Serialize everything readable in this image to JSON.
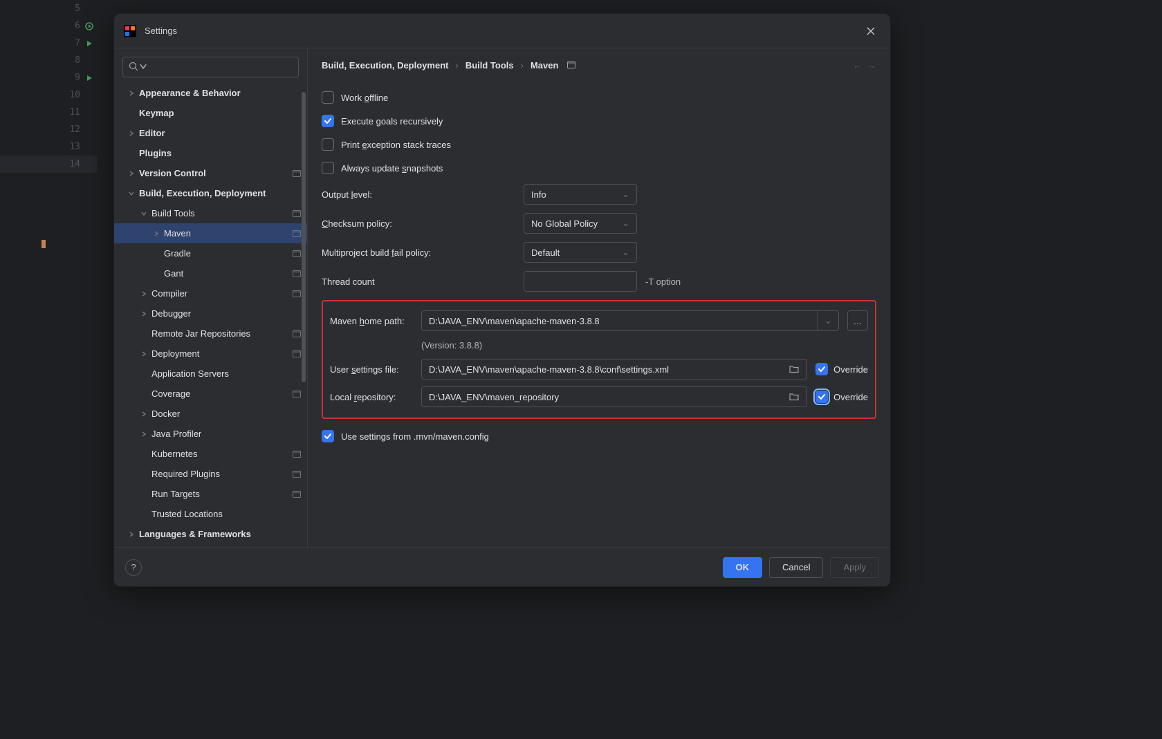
{
  "gutter": {
    "start": 5,
    "end": 14,
    "highlighted": 14,
    "run_icons": [
      6,
      7,
      9
    ]
  },
  "dialog": {
    "title": "Settings",
    "search_placeholder": "",
    "breadcrumbs": [
      "Build, Execution, Deployment",
      "Build Tools",
      "Maven"
    ],
    "tree": [
      {
        "label": "Appearance & Behavior",
        "arrow": "right",
        "bold": true,
        "proj": false
      },
      {
        "label": "Keymap",
        "arrow": "none",
        "bold": true,
        "proj": false
      },
      {
        "label": "Editor",
        "arrow": "right",
        "bold": true,
        "proj": false
      },
      {
        "label": "Plugins",
        "arrow": "none",
        "bold": true,
        "proj": false
      },
      {
        "label": "Version Control",
        "arrow": "right",
        "bold": true,
        "proj": true
      },
      {
        "label": "Build, Execution, Deployment",
        "arrow": "down",
        "bold": true,
        "proj": false
      },
      {
        "label": "Build Tools",
        "arrow": "down",
        "indent": 1,
        "proj": true
      },
      {
        "label": "Maven",
        "arrow": "right",
        "indent": 2,
        "proj": true,
        "selected": true
      },
      {
        "label": "Gradle",
        "arrow": "none",
        "indent": 2,
        "proj": true
      },
      {
        "label": "Gant",
        "arrow": "none",
        "indent": 2,
        "proj": true
      },
      {
        "label": "Compiler",
        "arrow": "right",
        "indent": 1,
        "proj": true
      },
      {
        "label": "Debugger",
        "arrow": "right",
        "indent": 1,
        "proj": false
      },
      {
        "label": "Remote Jar Repositories",
        "arrow": "none",
        "indent": 1,
        "proj": true
      },
      {
        "label": "Deployment",
        "arrow": "right",
        "indent": 1,
        "proj": true
      },
      {
        "label": "Application Servers",
        "arrow": "none",
        "indent": 1,
        "proj": false
      },
      {
        "label": "Coverage",
        "arrow": "none",
        "indent": 1,
        "proj": true
      },
      {
        "label": "Docker",
        "arrow": "right",
        "indent": 1,
        "proj": false
      },
      {
        "label": "Java Profiler",
        "arrow": "right",
        "indent": 1,
        "proj": false
      },
      {
        "label": "Kubernetes",
        "arrow": "none",
        "indent": 1,
        "proj": true
      },
      {
        "label": "Required Plugins",
        "arrow": "none",
        "indent": 1,
        "proj": true
      },
      {
        "label": "Run Targets",
        "arrow": "none",
        "indent": 1,
        "proj": true
      },
      {
        "label": "Trusted Locations",
        "arrow": "none",
        "indent": 1,
        "proj": false
      },
      {
        "label": "Languages & Frameworks",
        "arrow": "right",
        "bold": true,
        "proj": false
      }
    ],
    "checks": {
      "work_offline": {
        "label": "Work offline",
        "underline": "o",
        "checked": false
      },
      "exec_goals": {
        "label": "Execute goals recursively",
        "underline": "g",
        "checked": true
      },
      "print_exc": {
        "label": "Print exception stack traces",
        "underline": "e",
        "checked": false
      },
      "update_snap": {
        "label": "Always update snapshots",
        "underline": "s",
        "checked": false
      },
      "use_mvn_config": {
        "label": "Use settings from .mvn/maven.config",
        "checked": true
      }
    },
    "fields": {
      "output_level": {
        "label": "Output level:",
        "underline": "l",
        "value": "Info"
      },
      "checksum": {
        "label": "Checksum policy:",
        "underline": "C",
        "value": "No Global Policy"
      },
      "multiproject": {
        "label": "Multiproject build fail policy:",
        "underline": "f",
        "value": "Default"
      },
      "thread_count": {
        "label": "Thread count",
        "suffix": "-T option",
        "value": ""
      },
      "maven_home": {
        "label": "Maven home path:",
        "underline": "h",
        "value": "D:\\JAVA_ENV\\maven\\apache-maven-3.8.8"
      },
      "version": "(Version: 3.8.8)",
      "user_settings": {
        "label": "User settings file:",
        "underline": "s",
        "value": "D:\\JAVA_ENV\\maven\\apache-maven-3.8.8\\conf\\settings.xml",
        "override": true
      },
      "local_repo": {
        "label": "Local repository:",
        "underline": "r",
        "value": "D:\\JAVA_ENV\\maven_repository",
        "override": true,
        "focus": true
      },
      "override_label": "Override"
    },
    "footer": {
      "ok": "OK",
      "cancel": "Cancel",
      "apply": "Apply"
    }
  }
}
